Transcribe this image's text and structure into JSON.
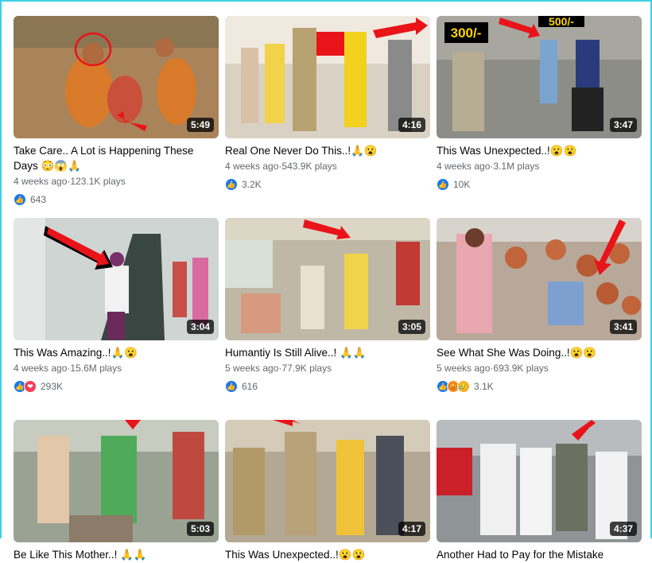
{
  "videos": [
    {
      "title": "Take Care.. A Lot is Happening These Days 😳😱🙏",
      "age": "4 weeks ago",
      "plays": "123.1K plays",
      "reactions": [
        "like"
      ],
      "count": "643",
      "duration": "5:49",
      "overlay": "",
      "bg": "#b08a5a"
    },
    {
      "title": "Real One Never Do This..!🙏😮",
      "age": "4 weeks ago",
      "plays": "543.9K plays",
      "reactions": [
        "like"
      ],
      "count": "3.2K",
      "duration": "4:16",
      "overlay": "",
      "bg": "#c7a877"
    },
    {
      "title": "This Was Unexpected..!😮😮",
      "age": "4 weeks ago",
      "plays": "3.1M plays",
      "reactions": [
        "like"
      ],
      "count": "10K",
      "duration": "3:47",
      "overlay": "300/- 500/-",
      "bg": "#8a8a8a"
    },
    {
      "title": "This Was Amazing..!🙏😮",
      "age": "4 weeks ago",
      "plays": "15.6M plays",
      "reactions": [
        "like",
        "love"
      ],
      "count": "293K",
      "duration": "3:04",
      "overlay": "",
      "bg": "#5c6b66"
    },
    {
      "title": "Humantiy Is Still Alive..! 🙏🙏",
      "age": "5 weeks ago",
      "plays": "77.9K plays",
      "reactions": [
        "like"
      ],
      "count": "616",
      "duration": "3:05",
      "overlay": "",
      "bg": "#a39c8c"
    },
    {
      "title": "See What She Was Doing..!😮😮",
      "age": "5 weeks ago",
      "plays": "693.9K plays",
      "reactions": [
        "like",
        "angry",
        "sad"
      ],
      "count": "3.1K",
      "duration": "3:41",
      "overlay": "",
      "bg": "#b46a43"
    },
    {
      "title": "Be Like This Mother..! 🙏🙏",
      "age": "",
      "plays": "",
      "reactions": [],
      "count": "",
      "duration": "5:03",
      "overlay": "",
      "bg": "#8a9a82"
    },
    {
      "title": "This Was Unexpected..!😮😮",
      "age": "",
      "plays": "",
      "reactions": [],
      "count": "",
      "duration": "4:17",
      "overlay": "",
      "bg": "#9b8a75"
    },
    {
      "title": "Another Had to Pay for the Mistake",
      "age": "",
      "plays": "",
      "reactions": [],
      "count": "",
      "duration": "4:37",
      "overlay": "",
      "bg": "#7f8a8f"
    }
  ],
  "colors": {
    "accent": "#1877f2",
    "frame": "#3cd0e6",
    "arrow": "#e8141a"
  }
}
